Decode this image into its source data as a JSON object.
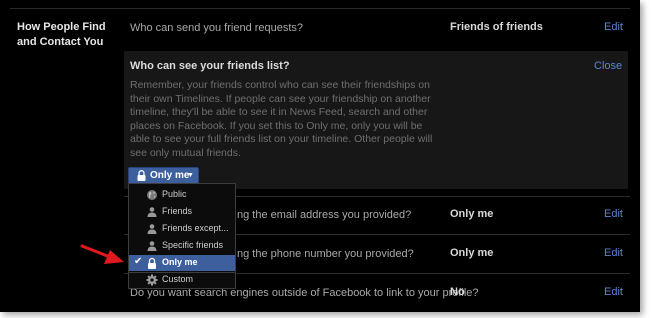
{
  "section": {
    "title": "How People Find and Contact You"
  },
  "rows": {
    "friend_requests": {
      "question": "Who can send you friend requests?",
      "value": "Friends of friends",
      "edit": "Edit"
    },
    "email": {
      "question": "ng the email address you provided?",
      "value": "Only me",
      "edit": "Edit"
    },
    "phone": {
      "question": "ng the phone number you provided?",
      "value": "Only me",
      "edit": "Edit"
    },
    "search": {
      "question": "Do you want search engines outside of Facebook to link to your profile?",
      "value": "No",
      "edit": "Edit"
    }
  },
  "expanded": {
    "title": "Who can see your friends list?",
    "close": "Close",
    "description": "Remember, your friends control who can see their friendships on their own Timelines. If people can see your friendship on another timeline, they'll be able to see it in News Feed, search and other places on Facebook. If you set this to Only me, only you will be able to see your full friends list on your timeline. Other people will see only mutual friends."
  },
  "audience_button": {
    "label": "Only me",
    "icon": "lock-icon"
  },
  "audience_menu": {
    "items": [
      {
        "label": "Public",
        "icon": "globe-icon"
      },
      {
        "label": "Friends",
        "icon": "person-icon"
      },
      {
        "label": "Friends except...",
        "icon": "person-icon"
      },
      {
        "label": "Specific friends",
        "icon": "person-icon"
      },
      {
        "label": "Only me",
        "icon": "lock-icon",
        "selected": true
      },
      {
        "label": "Custom",
        "icon": "gear-icon"
      }
    ]
  },
  "colors": {
    "accent": "#3e5f9e",
    "link": "#5b86d1",
    "annotation_arrow": "#e0191f"
  }
}
